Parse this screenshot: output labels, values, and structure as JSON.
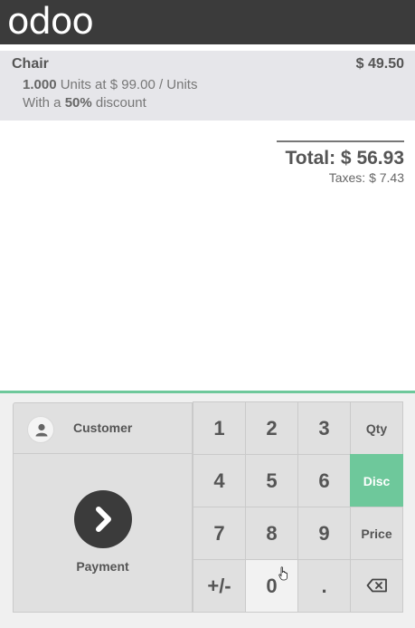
{
  "brand": {
    "logo": "odoo"
  },
  "order": {
    "line": {
      "product": "Chair",
      "price": "$ 49.50",
      "qty": "1.000",
      "unit_text": " Units at $ 99.00 / Units",
      "discount_prefix": "With a ",
      "discount": "50%",
      "discount_suffix": " discount"
    },
    "total": "Total: $ 56.93",
    "taxes": "Taxes: $ 7.43"
  },
  "actions": {
    "customer_label": "Customer",
    "payment_label": "Payment"
  },
  "numpad": {
    "keys": [
      "1",
      "2",
      "3",
      "Qty",
      "4",
      "5",
      "6",
      "Disc",
      "7",
      "8",
      "9",
      "Price",
      "+/-",
      "0",
      ".",
      "⌫"
    ],
    "selected_mode": "Disc"
  },
  "colors": {
    "accent": "#6ec89b",
    "topbar": "#3b3b3b",
    "selected_line": "#e6e6ea"
  },
  "icons": {
    "avatar": "person-icon",
    "payment": "chevron-right-icon",
    "backspace": "backspace-icon"
  }
}
